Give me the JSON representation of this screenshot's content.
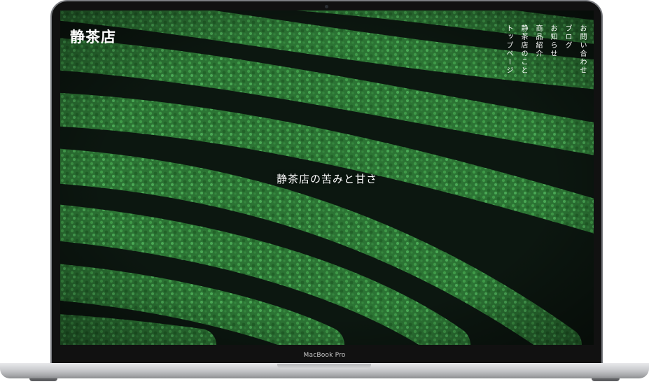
{
  "site": {
    "logo": "静茶店",
    "tagline": "静茶店の苦みと甘さ",
    "nav": [
      {
        "label": "トップページ"
      },
      {
        "label": "静茶店のこと"
      },
      {
        "label": "商品紹介"
      },
      {
        "label": "お知らせ"
      },
      {
        "label": "ブログ"
      },
      {
        "label": "お問い合わせ"
      }
    ]
  },
  "device": {
    "label": "MacBook Pro"
  },
  "colors": {
    "hero_dark": "#0e1c12",
    "tea_green": "#2f7a3a",
    "text": "#ffffff"
  }
}
